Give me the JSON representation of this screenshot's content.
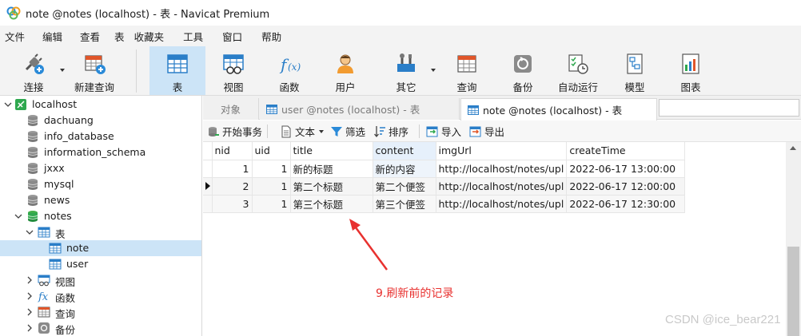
{
  "window": {
    "title": "note @notes (localhost) - 表 - Navicat Premium"
  },
  "menu": [
    "文件",
    "编辑",
    "查看",
    "表",
    "收藏夹",
    "工具",
    "窗口",
    "帮助"
  ],
  "toolbar": {
    "buttons": [
      {
        "label": "连接",
        "icon": "plug-connect-icon"
      },
      {
        "label": "新建查询",
        "icon": "new-query-icon"
      },
      {
        "label": "表",
        "icon": "table-icon",
        "active": true
      },
      {
        "label": "视图",
        "icon": "view-icon"
      },
      {
        "label": "函数",
        "icon": "function-icon"
      },
      {
        "label": "用户",
        "icon": "user-icon"
      },
      {
        "label": "其它",
        "icon": "tools-icon"
      },
      {
        "label": "查询",
        "icon": "query-icon"
      },
      {
        "label": "备份",
        "icon": "backup-icon"
      },
      {
        "label": "自动运行",
        "icon": "schedule-icon"
      },
      {
        "label": "模型",
        "icon": "model-icon"
      },
      {
        "label": "图表",
        "icon": "chart-icon"
      }
    ]
  },
  "sidebar": {
    "items": [
      {
        "label": "localhost",
        "icon": "connection-icon",
        "expanded": true
      },
      {
        "label": "dachuang",
        "icon": "database-icon"
      },
      {
        "label": "info_database",
        "icon": "database-icon"
      },
      {
        "label": "information_schema",
        "icon": "database-icon"
      },
      {
        "label": "jxxx",
        "icon": "database-icon"
      },
      {
        "label": "mysql",
        "icon": "database-icon"
      },
      {
        "label": "news",
        "icon": "database-icon"
      },
      {
        "label": "notes",
        "icon": "database-icon",
        "expanded": true
      },
      {
        "label": "表",
        "icon": "table-folder-icon",
        "expanded": true
      },
      {
        "label": "note",
        "icon": "table-icon",
        "selected": true
      },
      {
        "label": "user",
        "icon": "table-icon"
      },
      {
        "label": "视图",
        "icon": "view-icon"
      },
      {
        "label": "函数",
        "icon": "function-icon"
      },
      {
        "label": "查询",
        "icon": "query-icon"
      },
      {
        "label": "备份",
        "icon": "backup-icon"
      }
    ]
  },
  "tabs": [
    {
      "label": "对象",
      "state": "inactive"
    },
    {
      "label": "user @notes (localhost) - 表",
      "state": "inactive"
    },
    {
      "label": "note @notes (localhost) - 表",
      "state": "current"
    }
  ],
  "subtoolbar": {
    "begin_transaction": "开始事务",
    "text": "文本",
    "filter": "筛选",
    "sort": "排序",
    "import": "导入",
    "export": "导出"
  },
  "grid": {
    "columns": [
      "nid",
      "uid",
      "title",
      "content",
      "imgUrl",
      "createTime"
    ],
    "highlighted_column": "content",
    "rows": [
      [
        "1",
        "1",
        "新的标题",
        "新的内容",
        "http://localhost/notes/upl",
        "2022-06-17 13:00:00"
      ],
      [
        "2",
        "1",
        "第二个标题",
        "第二个便签",
        "http://localhost/notes/upl",
        "2022-06-17 12:00:00"
      ],
      [
        "3",
        "1",
        "第三个标题",
        "第三个便签",
        "http://localhost/notes/upl",
        "2022-06-17 12:30:00"
      ]
    ],
    "current_row": 2
  },
  "annotation": {
    "text": "9.刷新前的记录",
    "color": "#e8312f"
  },
  "watermark": "CSDN @ice_bear221",
  "colors": {
    "accent": "#cce4f7",
    "selection": "#cce4f7",
    "annotation": "#e8312f"
  }
}
